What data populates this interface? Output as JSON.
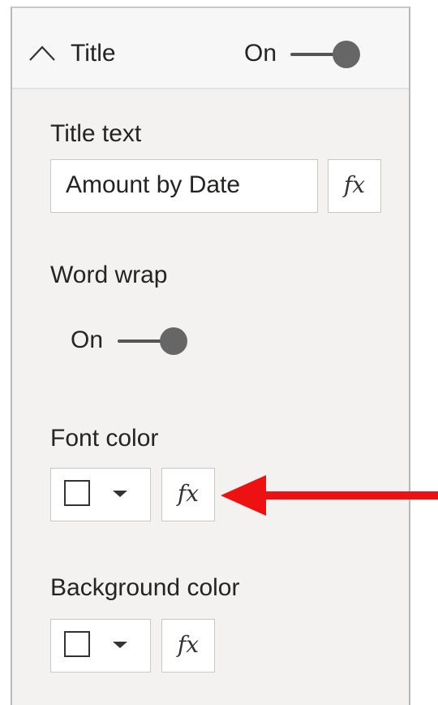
{
  "title_card": {
    "header_label": "Title",
    "toggle_label": "On",
    "toggle_state": "on",
    "title_text": {
      "label": "Title text",
      "value": "Amount by Date",
      "fx_label": "fx"
    },
    "word_wrap": {
      "label": "Word wrap",
      "toggle_label": "On",
      "toggle_state": "on"
    },
    "font_color": {
      "label": "Font color",
      "swatch_color": "#ffffff",
      "fx_label": "fx"
    },
    "background_color": {
      "label": "Background color",
      "swatch_color": "#ffffff",
      "fx_label": "fx"
    }
  },
  "annotation": {
    "arrow_color": "#ee1111",
    "points_to": "font_color.fx_button"
  },
  "icons": {
    "collapse": "chevron-up-icon",
    "dropdown": "caret-down-icon",
    "annotation": "arrow-left-icon"
  }
}
